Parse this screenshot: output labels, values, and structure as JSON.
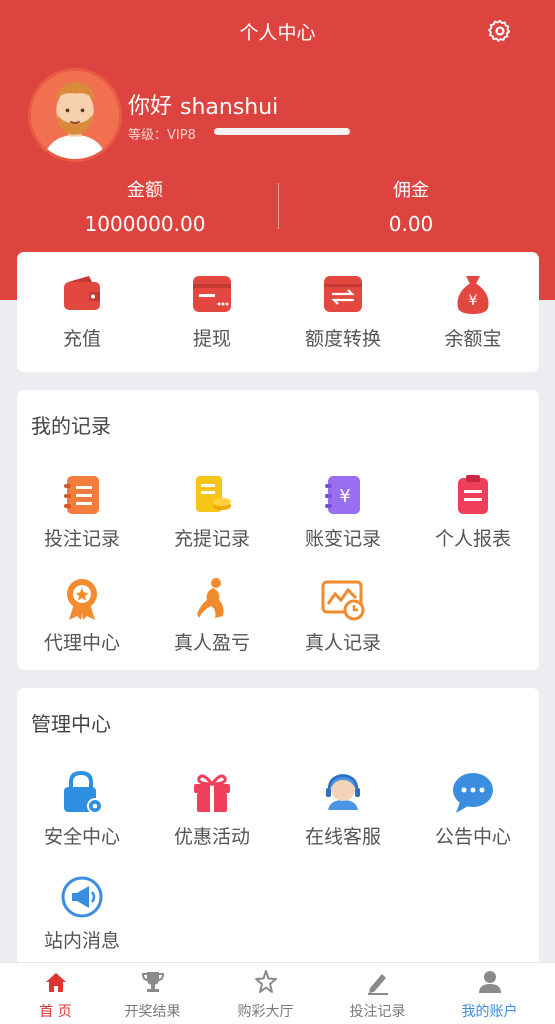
{
  "header": {
    "title": "个人中心"
  },
  "user": {
    "greeting": "你好",
    "username": "shanshui",
    "level_label": "等级：",
    "level_value": "VIP8",
    "progress": 1.0
  },
  "stats": {
    "balance_label": "金额",
    "balance_value": "1000000.00",
    "commission_label": "佣金",
    "commission_value": "0.00"
  },
  "wallet_actions": [
    {
      "label": "充值",
      "icon": "wallet-icon"
    },
    {
      "label": "提现",
      "icon": "card-icon"
    },
    {
      "label": "额度转换",
      "icon": "transfer-icon"
    },
    {
      "label": "余额宝",
      "icon": "money-bag-icon"
    }
  ],
  "records": {
    "title": "我的记录",
    "items": [
      {
        "label": "投注记录",
        "icon": "notebook-icon"
      },
      {
        "label": "充提记录",
        "icon": "document-coins-icon"
      },
      {
        "label": "账变记录",
        "icon": "yen-book-icon"
      },
      {
        "label": "个人报表",
        "icon": "clipboard-icon"
      },
      {
        "label": "代理中心",
        "icon": "medal-icon"
      },
      {
        "label": "真人盈亏",
        "icon": "dancer-icon"
      },
      {
        "label": "真人记录",
        "icon": "chart-clock-icon"
      }
    ]
  },
  "management": {
    "title": "管理中心",
    "items": [
      {
        "label": "安全中心",
        "icon": "lock-gear-icon"
      },
      {
        "label": "优惠活动",
        "icon": "gift-icon"
      },
      {
        "label": "在线客服",
        "icon": "headset-icon"
      },
      {
        "label": "公告中心",
        "icon": "chat-bubble-icon"
      },
      {
        "label": "站内消息",
        "icon": "megaphone-icon"
      }
    ]
  },
  "tabbar": [
    {
      "label": "首 页",
      "icon": "home-icon",
      "active": true
    },
    {
      "label": "开奖结果",
      "icon": "trophy-icon",
      "active": false
    },
    {
      "label": "购彩大厅",
      "icon": "star-icon",
      "active": false
    },
    {
      "label": "投注记录",
      "icon": "edit-icon",
      "active": false
    },
    {
      "label": "我的账户",
      "icon": "user-icon",
      "active": false
    }
  ],
  "colors": {
    "brand_red": "#dd4440",
    "tab_active_red": "#dd3333",
    "tab_selected_blue": "#3b8de0"
  }
}
